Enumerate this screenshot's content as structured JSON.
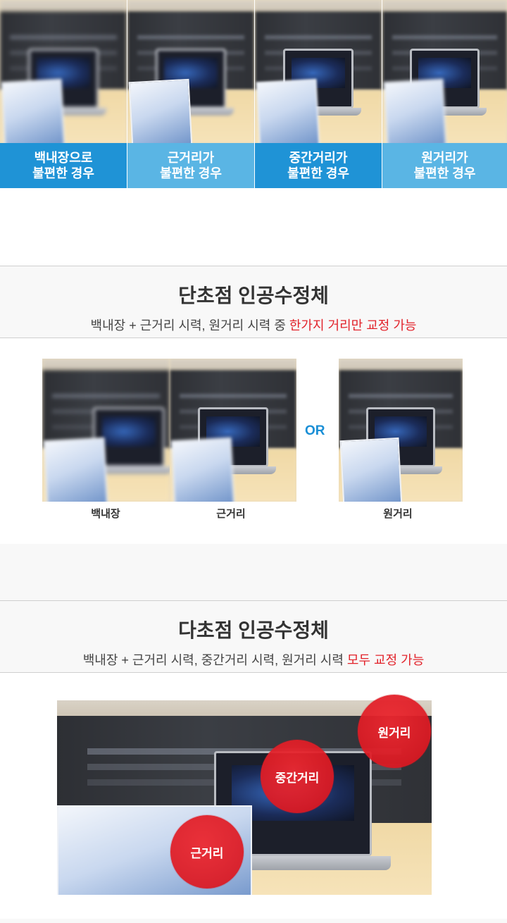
{
  "top_cards": [
    {
      "line1": "백내장으로",
      "line2": "불편한 경우",
      "color": "#1f93d6"
    },
    {
      "line1": "근거리가",
      "line2": "불편한 경우",
      "color": "#5ab5e4"
    },
    {
      "line1": "중간거리가",
      "line2": "불편한 경우",
      "color": "#1f93d6"
    },
    {
      "line1": "원거리가",
      "line2": "불편한 경우",
      "color": "#5ab5e4"
    }
  ],
  "mono": {
    "title": "단초점 인공수정체",
    "subtitle_plain": "백내장 + 근거리 시력, 원거리 시력 중 ",
    "subtitle_highlight": "한가지 거리만 교정 가능",
    "labels": {
      "cataract": "백내장",
      "near": "근거리",
      "or": "OR",
      "far": "원거리"
    }
  },
  "multi": {
    "title": "다초점 인공수정체",
    "subtitle_plain": "백내장 + 근거리 시력, 중간거리 시력, 원거리 시력 ",
    "subtitle_highlight": "모두 교정 가능",
    "bubbles": {
      "near": "근거리",
      "mid": "중간거리",
      "far": "원거리"
    }
  },
  "colors": {
    "accent_blue": "#1f93d6",
    "light_blue": "#5ab5e4",
    "highlight_red": "#e2222a"
  }
}
